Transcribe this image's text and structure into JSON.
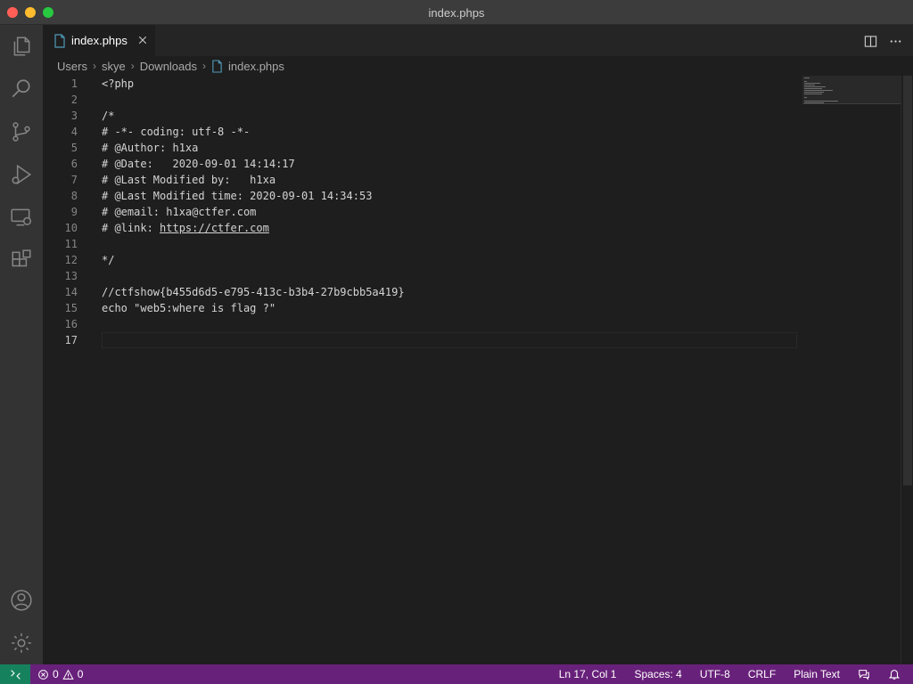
{
  "window": {
    "title": "index.phps"
  },
  "tab": {
    "label": "index.phps"
  },
  "breadcrumb": {
    "items": [
      "Users",
      "skye",
      "Downloads",
      "index.phps"
    ]
  },
  "editor": {
    "line_numbers": [
      "1",
      "2",
      "3",
      "4",
      "5",
      "6",
      "7",
      "8",
      "9",
      "10",
      "11",
      "12",
      "13",
      "14",
      "15",
      "16",
      "17"
    ],
    "active_line": 17,
    "lines": [
      "<?php",
      "",
      "/*",
      "# -*- coding: utf-8 -*-",
      "# @Author: h1xa",
      "# @Date:   2020-09-01 14:14:17",
      "# @Last Modified by:   h1xa",
      "# @Last Modified time: 2020-09-01 14:34:53",
      "# @email: h1xa@ctfer.com",
      "# @link: ",
      "",
      "*/",
      "",
      "//ctfshow{b455d6d5-e795-413c-b3b4-27b9cbb5a419}",
      "echo \"web5:where is flag ?\"",
      "",
      ""
    ],
    "link_text": "https://ctfer.com"
  },
  "status": {
    "errors": "0",
    "warnings": "0",
    "position": "Ln 17, Col 1",
    "spaces": "Spaces: 4",
    "encoding": "UTF-8",
    "eol": "CRLF",
    "language": "Plain Text"
  },
  "icons": {
    "activity": [
      "explorer-icon",
      "search-icon",
      "source-control-icon",
      "run-debug-icon",
      "remote-explorer-icon",
      "extensions-icon",
      "accounts-icon",
      "manage-gear-icon"
    ],
    "file": "file-icon"
  },
  "colors": {
    "status_bar": "#68217a",
    "remote_indicator": "#16825d",
    "file_icon": "#519aba"
  }
}
